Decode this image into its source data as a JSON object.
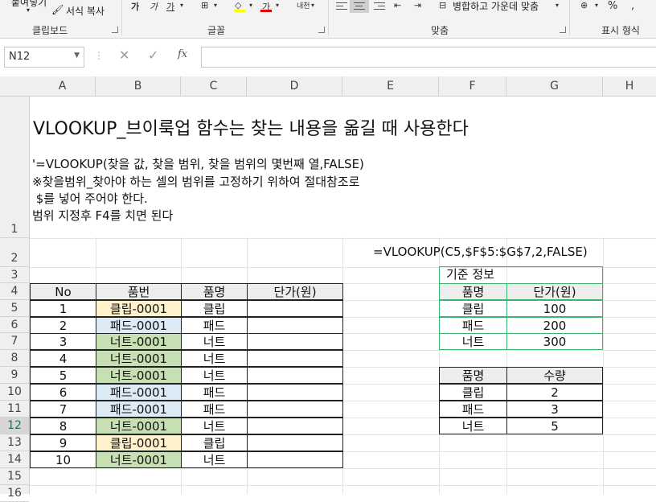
{
  "ribbon": {
    "clipboard": {
      "paste_label": "붙여넣기",
      "format_painter_label": "서식 복사",
      "group_label": "클립보드"
    },
    "font": {
      "group_label": "글꼴",
      "bold": "가",
      "italic": "가",
      "underline": "가",
      "font_color": "가"
    },
    "alignment": {
      "group_label": "맞춤",
      "wrap_label": "내용",
      "merge_label": "병합하고 가운데 맞춤"
    },
    "number": {
      "group_label": "표시 형식",
      "percent": "%",
      "comma": ","
    }
  },
  "formula_bar": {
    "name_box": "N12",
    "fx": "fx",
    "value": ""
  },
  "columns": [
    "A",
    "B",
    "C",
    "D",
    "E",
    "F",
    "G",
    "H"
  ],
  "rows": [
    "1",
    "2",
    "3",
    "4",
    "5",
    "6",
    "7",
    "8",
    "9",
    "10",
    "11",
    "12",
    "13",
    "14",
    "15",
    "16"
  ],
  "sheet": {
    "title": "VLOOKUP_브이룩업 함수는 찾는 내용을 옮길 때 사용한다",
    "notes": [
      "'=VLOOKUP(찾을 값, 찾을 범위, 찾을 범위의 몇번째 열,FALSE)",
      "※찾을범위_찾아야 하는 셀의 범위를 고정하기 위하여 절대참조로",
      " $를 넣어 주어야 한다.",
      "범위 지정후 F4를 치면 된다"
    ],
    "formula_example": "=VLOOKUP(C5,$F$5:$G$7,2,FALSE)",
    "main_table": {
      "headers": [
        "No",
        "품번",
        "품명",
        "단가(원)"
      ],
      "rows": [
        {
          "no": "1",
          "code": "클립-0001",
          "name": "클립",
          "price": ""
        },
        {
          "no": "2",
          "code": "패드-0001",
          "name": "패드",
          "price": ""
        },
        {
          "no": "3",
          "code": "너트-0001",
          "name": "너트",
          "price": ""
        },
        {
          "no": "4",
          "code": "너트-0001",
          "name": "너트",
          "price": ""
        },
        {
          "no": "5",
          "code": "너트-0001",
          "name": "너트",
          "price": ""
        },
        {
          "no": "6",
          "code": "패드-0001",
          "name": "패드",
          "price": ""
        },
        {
          "no": "7",
          "code": "패드-0001",
          "name": "패드",
          "price": ""
        },
        {
          "no": "8",
          "code": "너트-0001",
          "name": "너트",
          "price": ""
        },
        {
          "no": "9",
          "code": "클립-0001",
          "name": "클립",
          "price": ""
        },
        {
          "no": "10",
          "code": "너트-0001",
          "name": "너트",
          "price": ""
        }
      ]
    },
    "ref_table": {
      "title": "기준 정보",
      "headers": [
        "품명",
        "단가(원)"
      ],
      "rows": [
        {
          "name": "클립",
          "price": "100"
        },
        {
          "name": "패드",
          "price": "200"
        },
        {
          "name": "너트",
          "price": "300"
        }
      ]
    },
    "qty_table": {
      "headers": [
        "품명",
        "수량"
      ],
      "rows": [
        {
          "name": "클립",
          "qty": "2"
        },
        {
          "name": "패드",
          "qty": "3"
        },
        {
          "name": "너트",
          "qty": "5"
        }
      ]
    }
  },
  "colors": {
    "green_fill": "#c6e0b4",
    "blue_fill": "#ddebf7",
    "orange_fill": "#fff2cc",
    "ref_border": "#3cb371",
    "excel_green": "#217346"
  }
}
